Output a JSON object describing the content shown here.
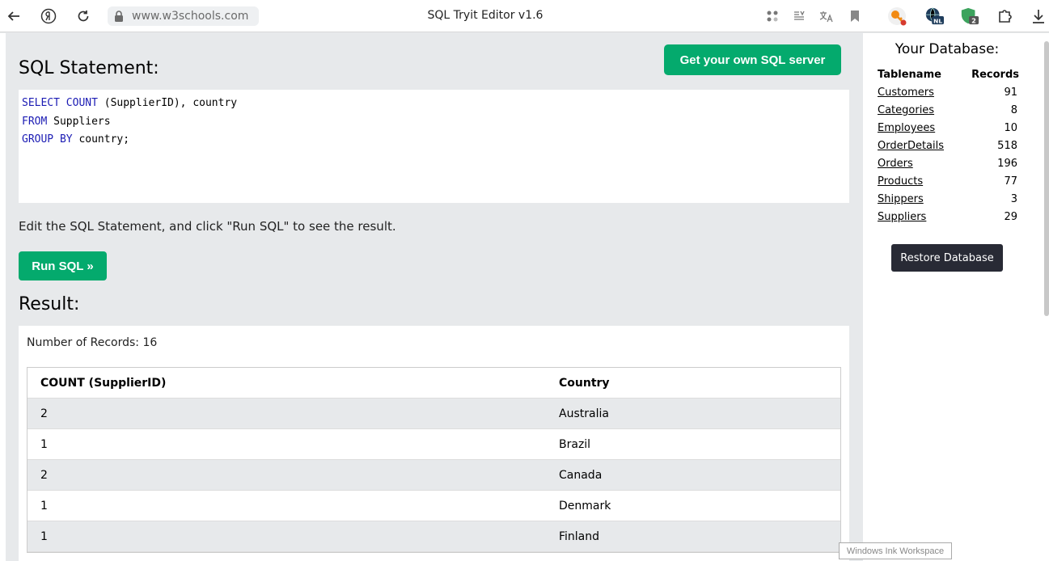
{
  "browser": {
    "url": "www.w3schools.com",
    "page_title": "SQL Tryit Editor v1.6",
    "ext_badge_nl": "NL",
    "ext_badge_2": "2"
  },
  "main": {
    "sql_heading": "SQL Statement:",
    "get_server_label": "Get your own SQL server",
    "code_lines": [
      [
        {
          "t": "SELECT COUNT",
          "k": true
        },
        {
          "t": " (SupplierID), country",
          "k": false
        }
      ],
      [
        {
          "t": "FROM",
          "k": true
        },
        {
          "t": " Suppliers",
          "k": false
        }
      ],
      [
        {
          "t": "GROUP BY",
          "k": true
        },
        {
          "t": " country;",
          "k": false
        }
      ]
    ],
    "instruction": "Edit the SQL Statement, and click \"Run SQL\" to see the result.",
    "run_label": "Run SQL »",
    "result_heading": "Result:",
    "num_records": "Number of Records: 16",
    "table_headers": [
      "COUNT (SupplierID)",
      "Country"
    ],
    "table_rows": [
      [
        "2",
        "Australia"
      ],
      [
        "1",
        "Brazil"
      ],
      [
        "2",
        "Canada"
      ],
      [
        "1",
        "Denmark"
      ],
      [
        "1",
        "Finland"
      ]
    ]
  },
  "sidebar": {
    "title": "Your Database:",
    "col_tablename": "Tablename",
    "col_records": "Records",
    "tables": [
      {
        "name": "Customers",
        "records": "91"
      },
      {
        "name": "Categories",
        "records": "8"
      },
      {
        "name": "Employees",
        "records": "10"
      },
      {
        "name": "OrderDetails",
        "records": "518"
      },
      {
        "name": "Orders",
        "records": "196"
      },
      {
        "name": "Products",
        "records": "77"
      },
      {
        "name": "Shippers",
        "records": "3"
      },
      {
        "name": "Suppliers",
        "records": "29"
      }
    ],
    "restore_label": "Restore Database"
  },
  "tooltip": "Windows Ink Workspace",
  "colors": {
    "accent_green": "#04aa6d",
    "dark_button": "#282a35",
    "keyword_blue": "#1c1cb4",
    "panel_bg": "#e7e9eb"
  }
}
